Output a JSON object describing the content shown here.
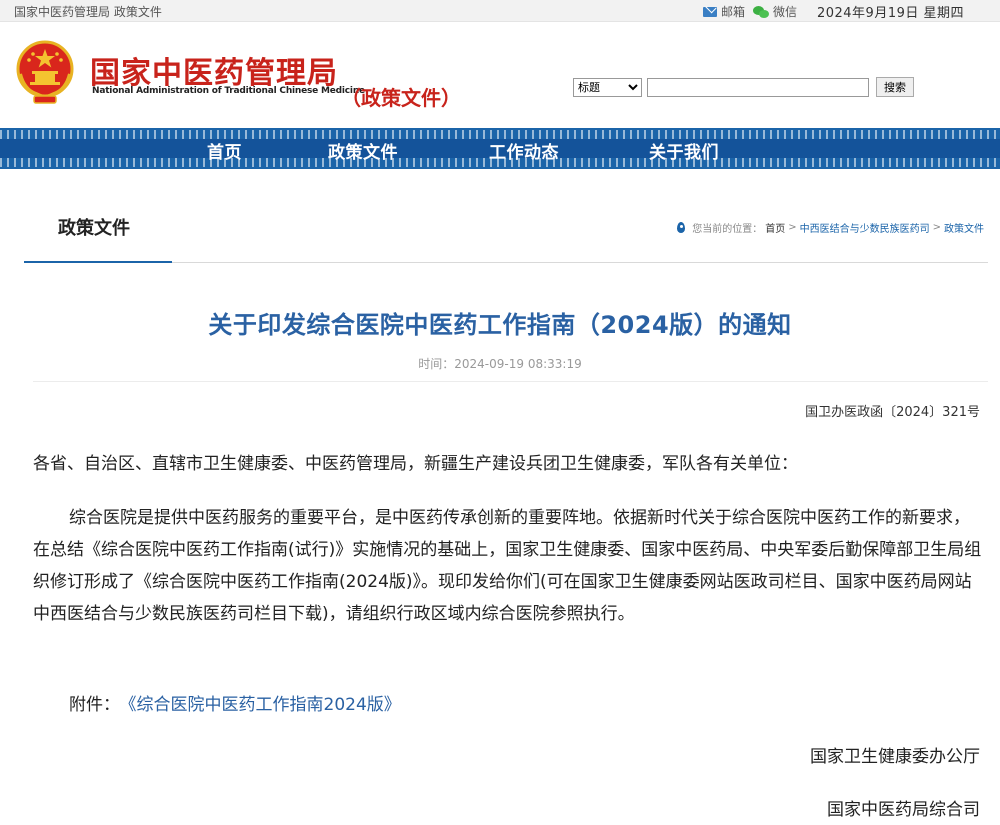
{
  "topbar": {
    "crumb": "国家中医药管理局 政策文件",
    "mail_label": "邮箱",
    "wechat_label": "微信",
    "date": "2024年9月19日 星期四"
  },
  "header": {
    "brand_cn": "国家中医药管理局",
    "brand_en": "National Administration of Traditional Chinese Medicine",
    "section_tag": "（政策文件）",
    "search_select_value": "标题",
    "search_input_value": "",
    "search_button": "搜索"
  },
  "nav": {
    "items": [
      "首页",
      "政策文件",
      "工作动态",
      "关于我们"
    ]
  },
  "colors": {
    "brand_red": "#c8231b",
    "nav_blue": "#1b64a9",
    "title_blue": "#2a61a3"
  },
  "content": {
    "tab_title": "政策文件",
    "breadcrumb": {
      "prefix": "您当前的位置：",
      "home": "首页",
      "sep": ">",
      "level1": "中西医结合与少数民族医药司",
      "level2": "政策文件"
    },
    "article": {
      "title": "关于印发综合医院中医药工作指南（2024版）的通知",
      "time": "时间：2024-09-19 08:33:19",
      "doc_no": "国卫办医政函〔2024〕321号",
      "salutation": "各省、自治区、直辖市卫生健康委、中医药管理局，新疆生产建设兵团卫生健康委，军队各有关单位：",
      "body": "综合医院是提供中医药服务的重要平台，是中医药传承创新的重要阵地。依据新时代关于综合医院中医药工作的新要求，在总结《综合医院中医药工作指南(试行)》实施情况的基础上，国家卫生健康委、国家中医药局、中央军委后勤保障部卫生局组织修订形成了《综合医院中医药工作指南(2024版)》。现印发给你们(可在国家卫生健康委网站医政司栏目、国家中医药局网站中西医结合与少数民族医药司栏目下载)，请组织行政区域内综合医院参照执行。",
      "attachment_label": "附件：",
      "attachment_link": "《综合医院中医药工作指南2024版》",
      "signature1": "国家卫生健康委办公厅",
      "signature2": "国家中医药局综合司"
    }
  }
}
